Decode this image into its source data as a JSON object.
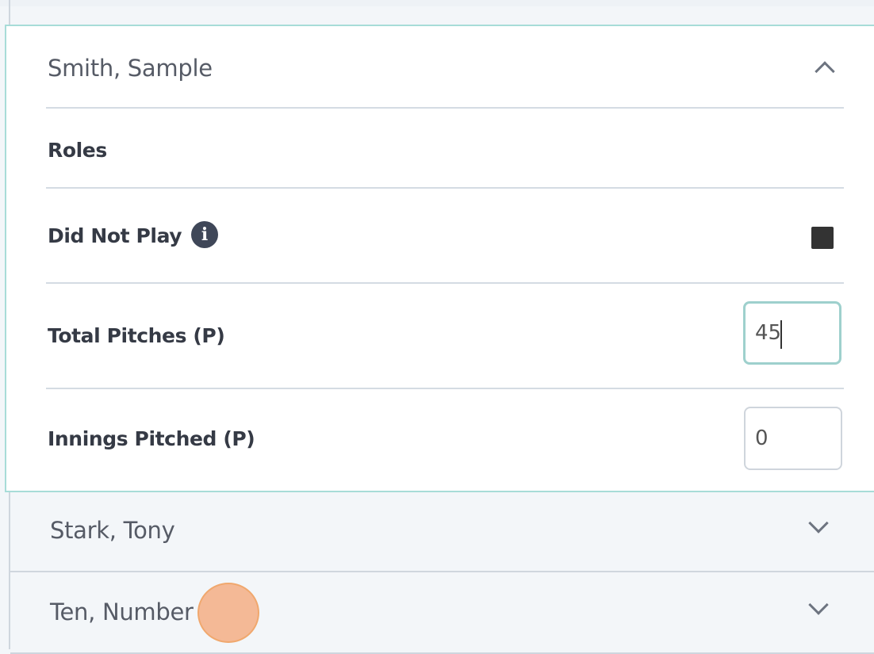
{
  "expanded_player": {
    "name": "Smith, Sample",
    "toggle_icon": "chevron-up-icon",
    "rows": {
      "roles": {
        "label": "Roles"
      },
      "did_not_play": {
        "label": "Did Not Play",
        "info_icon": "info-icon",
        "checked": true
      },
      "total_pitches": {
        "label": "Total Pitches (P)",
        "value": "45"
      },
      "innings_pitched": {
        "label": "Innings Pitched (P)",
        "value": "0"
      }
    }
  },
  "collapsed_players": [
    {
      "name": "Stark, Tony",
      "toggle_icon": "chevron-down-icon"
    },
    {
      "name": "Ten, Number",
      "toggle_icon": "chevron-down-icon"
    }
  ],
  "colors": {
    "accent_border": "#a7dcd8",
    "click_indicator": "#f4a474"
  }
}
